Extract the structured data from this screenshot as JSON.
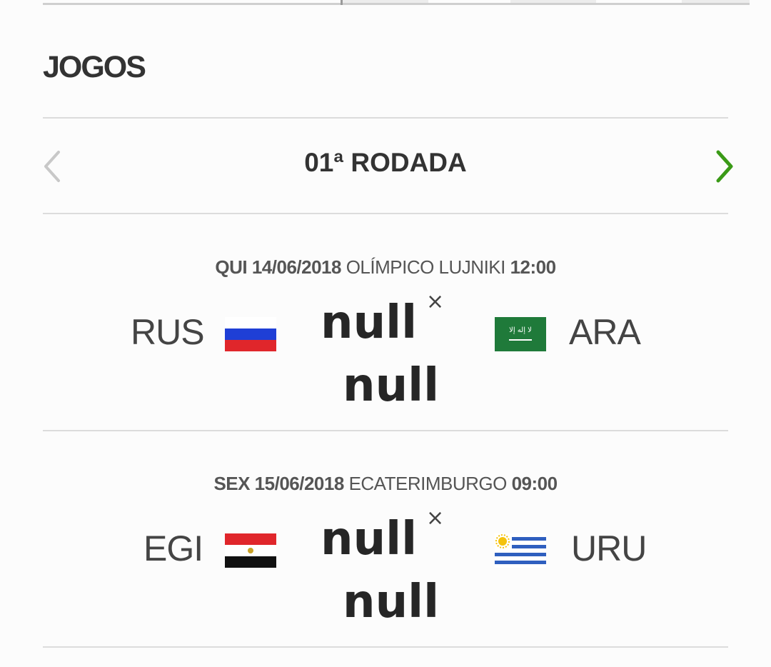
{
  "header": {
    "title": "JOGOS"
  },
  "round": {
    "label": "01ª RODADA",
    "prev_icon": "chevron-left-icon",
    "next_icon": "chevron-right-icon"
  },
  "colors": {
    "accent": "#3a9a17",
    "disabled": "#c8c8c8",
    "divider": "#dcdcdc"
  },
  "matches": [
    {
      "day": "QUI 14/06/2018",
      "venue": "OLÍMPICO LUJNIKI",
      "time": "12:00",
      "home": {
        "abbr": "RUS",
        "flag": "russia-flag-icon",
        "score": "null"
      },
      "separator": "×",
      "away": {
        "abbr": "ARA",
        "flag": "saudi-arabia-flag-icon",
        "score": "null"
      }
    },
    {
      "day": "SEX 15/06/2018",
      "venue": "ECATERIMBURGO",
      "time": "09:00",
      "home": {
        "abbr": "EGI",
        "flag": "egypt-flag-icon",
        "score": "null"
      },
      "separator": "×",
      "away": {
        "abbr": "URU",
        "flag": "uruguay-flag-icon",
        "score": "null"
      }
    }
  ]
}
